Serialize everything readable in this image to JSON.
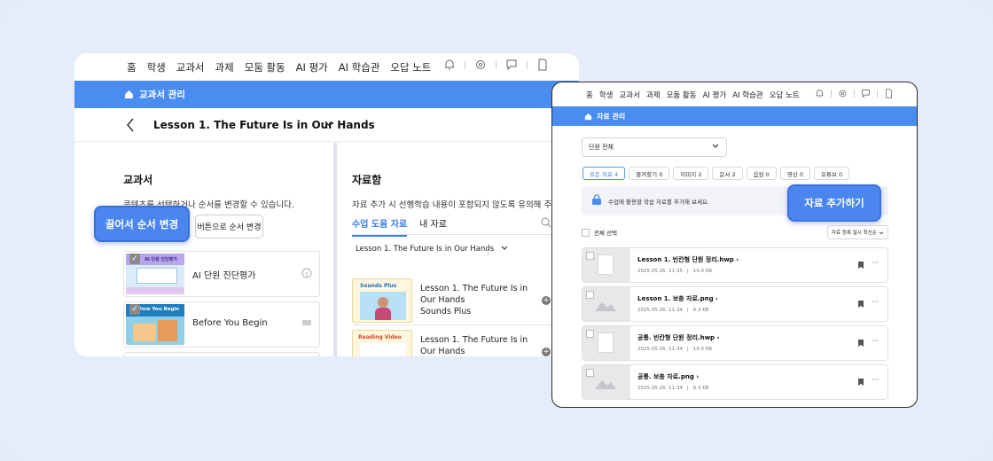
{
  "nav": {
    "items": [
      "홈",
      "학생",
      "교과서",
      "과제",
      "모둠 활동",
      "AI 평가",
      "AI 학습관",
      "오답 노트"
    ]
  },
  "left": {
    "breadcrumb": "교과서 관리",
    "lesson_title": "Lesson 1. The Future Is in Our Hands",
    "textbook": {
      "title": "교과서",
      "desc": "콘텐츠를 선택하거나 순서를 변경할 수 있습니다.",
      "order_button": "버튼으로 순서 변경",
      "drag_pill": "끌어서 순서 변경",
      "cards": [
        {
          "title": "AI 단원 진단평가",
          "thumb_label": "AI 단원 진단평가"
        },
        {
          "title": "Before You Begin",
          "thumb_label": "Before You Begin"
        }
      ]
    },
    "materials": {
      "title": "자료함",
      "desc": "자료 추가 시 선행학습 내용이 포함되지 않도록 유의해 주세요.",
      "tab_active": "수업 도움 자료",
      "tab_other": "내 자료",
      "lesson_select": "Lesson 1. The Future Is in Our Hands",
      "items": [
        {
          "title": "Lesson 1. The Future Is in Our Hands",
          "sub": "Sounds Plus",
          "thumb_label": "Sounds Plus"
        },
        {
          "title": "Lesson 1. The Future Is in Our Hands",
          "sub": "",
          "thumb_label": "Reading Video"
        }
      ]
    }
  },
  "right": {
    "breadcrumb": "자료 관리",
    "unit_select": "단원 전체",
    "filters": [
      "모든 자료 4",
      "즐겨찾기 0",
      "이미지 2",
      "문서 2",
      "음원 0",
      "영상 0",
      "유튜브 0"
    ],
    "hint": "수업에 활용할 학습 자료를 추가해 보세요.",
    "add_pill": "자료 추가하기",
    "select_all": "전체 선택",
    "sort": "자료 등록 일시 최신순",
    "files": [
      {
        "name": "Lesson 1. 빈칸형 단원 정리.hwp",
        "date": "2025.05.26. 11:35",
        "size": "14.0 KB",
        "kind": "doc"
      },
      {
        "name": "Lesson 1. 보충 자료.png",
        "date": "2025.05.26. 11:34",
        "size": "6.3 KB",
        "kind": "img"
      },
      {
        "name": "공통. 빈칸형 단원 정리.hwp",
        "date": "2025.05.26. 11:34",
        "size": "14.0 KB",
        "kind": "doc"
      },
      {
        "name": "공통. 보충 자료.png",
        "date": "2025.05.26. 11:34",
        "size": "6.3 KB",
        "kind": "img"
      }
    ]
  },
  "icons": {
    "home": "home-icon",
    "bell": "bell-icon",
    "settings": "gear-icon",
    "chat": "chat-icon",
    "doc": "document-icon",
    "back": "chevron-left-icon",
    "dropdown": "chevron-down-icon",
    "search": "search-icon",
    "bookmark": "bookmark-icon",
    "more": "more-icon",
    "info": "info-icon",
    "drag": "drag-handle-icon",
    "lock": "lock-icon"
  },
  "colors": {
    "accent": "#4a8df0",
    "pill": "#4a86ee",
    "background": "#e7ecfb"
  }
}
